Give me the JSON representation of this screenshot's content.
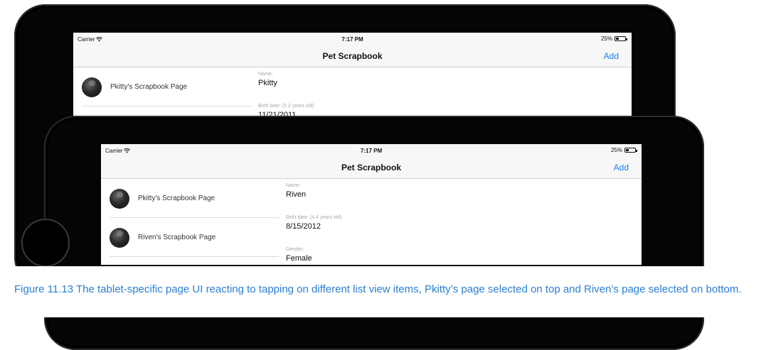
{
  "screens": {
    "top": {
      "status": {
        "carrier": "Carrier",
        "time": "7:17 PM",
        "battery": "25%",
        "battery_level": 0.25
      },
      "nav": {
        "title": "Pet Scrapbook",
        "add_label": "Add"
      },
      "list": [
        {
          "label": "Pkitty's Scrapbook Page"
        }
      ],
      "detail": {
        "name_label": "Name:",
        "name_value": "Pkitty",
        "birth_label": "Birth date: (5.2 years old)",
        "birth_value": "11/21/2011"
      }
    },
    "bottom": {
      "status": {
        "carrier": "Carrier",
        "time": "7:17 PM",
        "battery": "25%",
        "battery_level": 0.25
      },
      "nav": {
        "title": "Pet Scrapbook",
        "add_label": "Add"
      },
      "list": [
        {
          "label": "Pkitty's Scrapbook Page"
        },
        {
          "label": "Riven's Scrapbook Page"
        }
      ],
      "detail": {
        "name_label": "Name:",
        "name_value": "Riven",
        "birth_label": "Birth date: (4.4 years old)",
        "birth_value": "8/15/2012",
        "gender_label": "Gender:",
        "gender_value": "Female"
      }
    }
  },
  "caption": "Figure 11.13 The tablet-specific page UI reacting to tapping on different list view items, Pkitty’s page selected on top and Riven’s page selected on bottom.",
  "colors": {
    "accent": "#1a7cf5",
    "caption": "#2a7fd4",
    "frame": "#050505"
  },
  "icons": {
    "wifi": "wifi-icon",
    "battery": "battery-icon"
  }
}
